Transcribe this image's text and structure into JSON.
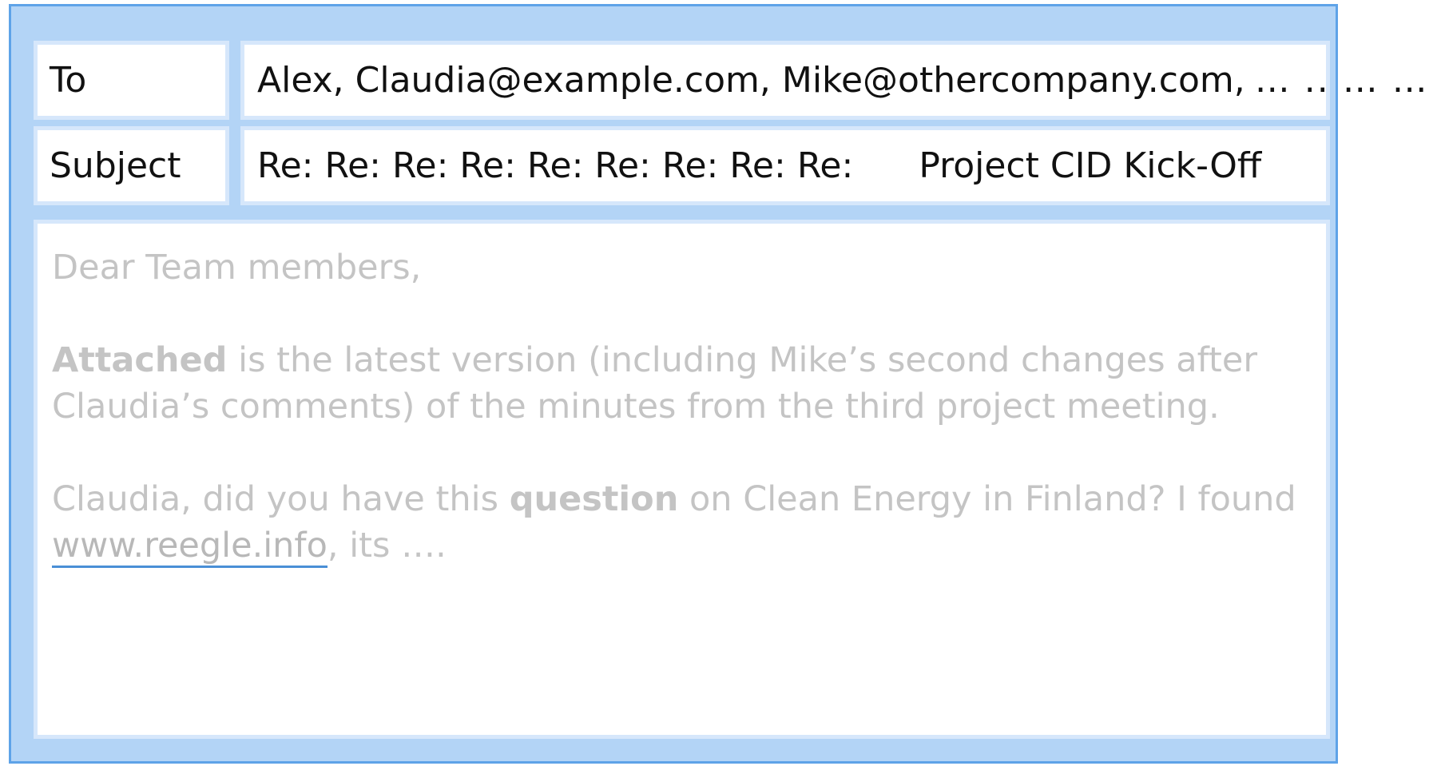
{
  "header": {
    "to_label": "To",
    "to_value": "Alex, Claudia@example.com, Mike@othercompany.com,",
    "to_overflow": "… .. … …",
    "subject_label": "Subject",
    "subject_prefix": "Re: Re: Re: Re: Re: Re: Re: Re: Re:",
    "subject_title": "Project CID Kick-Off"
  },
  "body": {
    "greeting": "Dear Team members,",
    "p1_bold": "Attached",
    "p1_rest": " is the latest version (including Mike’s second changes after Claudia’s comments) of the minutes from the third project meeting.",
    "p2_start": "Claudia, did you have this ",
    "p2_bold": "question",
    "p2_mid": " on Clean Energy in Finland? I found ",
    "p2_link": "www.reegle.info",
    "p2_end": ", its …."
  },
  "colors": {
    "frame": "#b3d4f6",
    "frame_border": "#5ea3e8",
    "field_border": "#d6e7fb",
    "body_text": "#c4c4c4",
    "link_underline": "#4a8fd6"
  }
}
